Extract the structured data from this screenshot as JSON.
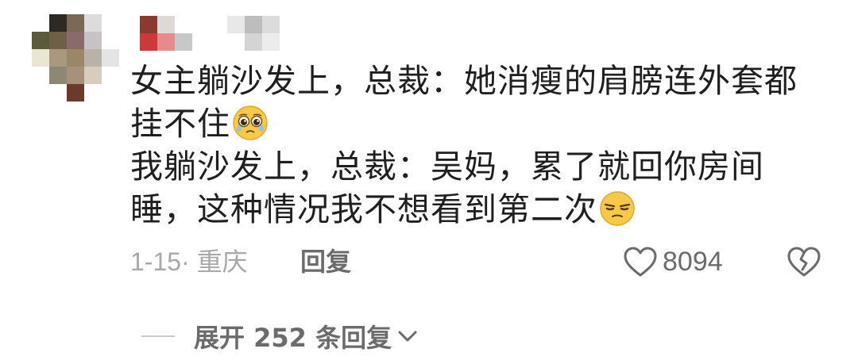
{
  "avatar": {
    "pixels": [
      "#ffffff",
      "#2e2a23",
      "#7a6a55",
      "#dcdcdc",
      "#ffffff",
      "#5c5a3a",
      "#6e6048",
      "#8a6a6a",
      "#c7c2c6",
      "#ffffff",
      "#eae6d2",
      "#a9977e",
      "#9b8668",
      "#b8b2a8",
      "#e4e4e4",
      "#ffffff",
      "#8d8871",
      "#a8917a",
      "#d8cdbd",
      "#ffffff",
      "#ffffff",
      "#ffffff",
      "#6b3a2a",
      "#ffffff",
      "#ffffff"
    ]
  },
  "username": {
    "pixels": [
      "#8a3a2e",
      "#e0d8d4",
      "#ffffff",
      "#ffffff",
      "#ffffff",
      "#e8e8e8",
      "#bdbdbd",
      "#dcdcdc",
      "#ffffff",
      "#c93b3b",
      "#e88a8a",
      "#c8c8c8",
      "#ffffff",
      "#ffffff",
      "#ffffff",
      "#d4d4d4",
      "#ececec",
      "#ffffff"
    ]
  },
  "comment": {
    "line1": "女主躺沙发上，总裁：她消瘦的肩膀连外套都",
    "line2": "挂不住",
    "line2_emoji": "crying-face-emoji",
    "line3": "我躺沙发上，总裁：吴妈，累了就回你房间",
    "line4": "睡，这种情况我不想看到第二次",
    "line4_emoji": "unamused-face-emoji"
  },
  "meta": {
    "date_location": "1-15· 重庆",
    "reply_label": "回复",
    "like_icon": "heart-outline-icon",
    "like_count": "8094",
    "dislike_icon": "broken-heart-icon"
  },
  "expand": {
    "label": "展开 252 条回复",
    "chevron_icon": "chevron-down-icon"
  },
  "colors": {
    "text_primary": "#1f1f1f",
    "text_secondary": "#a8a8a8",
    "text_action": "#6b6b6b",
    "divider": "#c8c8c8"
  }
}
